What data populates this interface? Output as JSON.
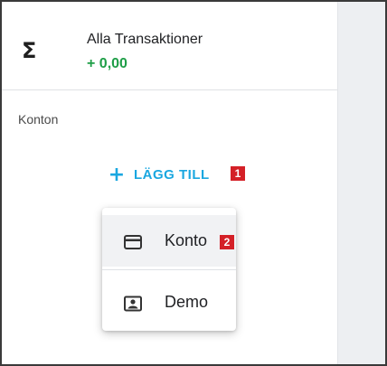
{
  "all_transactions": {
    "icon": "sigma-icon",
    "icon_glyph": "Σ",
    "title": "Alla Transaktioner",
    "amount": "+ 0,00",
    "amount_color": "#1e9e47"
  },
  "accounts_section": {
    "label": "Konton"
  },
  "add_button": {
    "icon": "plus-icon",
    "icon_glyph": "+",
    "label": "LÄGG TILL",
    "badge": "1",
    "color": "#1aa7e0"
  },
  "add_menu": {
    "items": [
      {
        "icon": "credit-card-icon",
        "label": "Konto",
        "badge": "2",
        "highlighted": true
      },
      {
        "icon": "contact-card-icon",
        "label": "Demo",
        "highlighted": false
      }
    ]
  },
  "colors": {
    "badge": "#d42027",
    "right_pane": "#edeff2"
  }
}
